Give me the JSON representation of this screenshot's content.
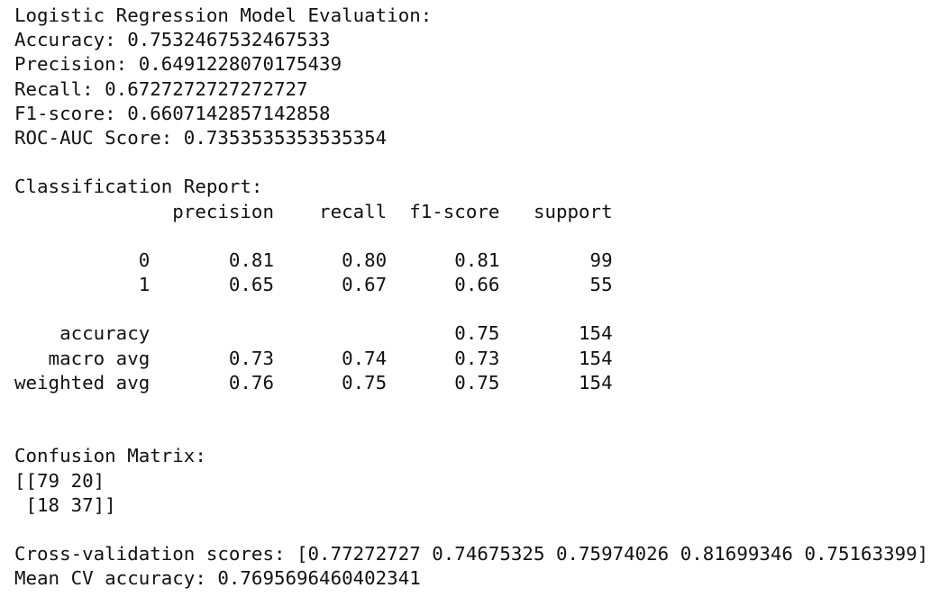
{
  "output": {
    "lines": [
      "Logistic Regression Model Evaluation:",
      "Accuracy: 0.7532467532467533",
      "Precision: 0.6491228070175439",
      "Recall: 0.6727272727272727",
      "F1-score: 0.6607142857142858",
      "ROC-AUC Score: 0.7353535353535354",
      "",
      "Classification Report:",
      "              precision    recall  f1-score   support",
      "",
      "           0       0.81      0.80      0.81        99",
      "           1       0.65      0.67      0.66        55",
      "",
      "    accuracy                           0.75       154",
      "   macro avg       0.73      0.74      0.73       154",
      "weighted avg       0.76      0.75      0.75       154",
      "",
      "",
      "Confusion Matrix:",
      "[[79 20]",
      " [18 37]]",
      "",
      "Cross-validation scores: [0.77272727 0.74675325 0.75974026 0.81699346 0.75163399]",
      "Mean CV accuracy: 0.7695696460402341"
    ]
  }
}
